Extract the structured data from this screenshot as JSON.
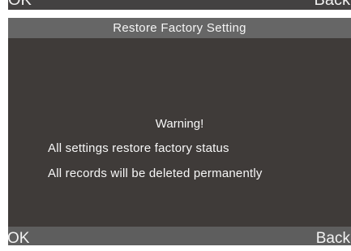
{
  "previous_screen": {
    "ok_label": "OK",
    "back_label": "Back"
  },
  "dialog": {
    "title": "Restore Factory Setting",
    "warning": "Warning!",
    "messages": [
      "All settings restore factory status",
      "All records will be deleted permanently"
    ]
  },
  "softkeys": {
    "ok_label": "OK",
    "back_label": "Back"
  },
  "colors": {
    "screen_background": "#3f3b39",
    "title_bar": "#666666",
    "softkey_bar": "#5e5e5e",
    "text": "#f7f7f7"
  }
}
